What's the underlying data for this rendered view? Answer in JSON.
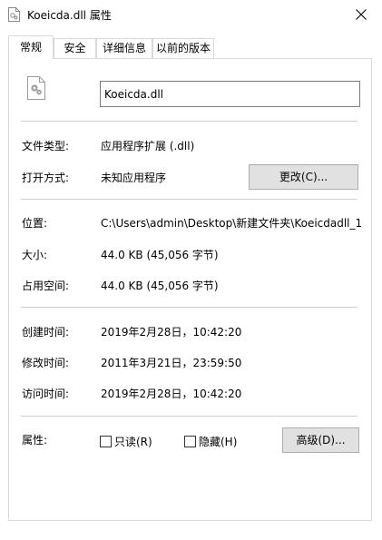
{
  "window": {
    "title": "Koeicda.dll 属性",
    "close_glyph": "✕"
  },
  "tabs": [
    {
      "label": "常规",
      "active": true
    },
    {
      "label": "安全",
      "active": false
    },
    {
      "label": "详细信息",
      "active": false
    },
    {
      "label": "以前的版本",
      "active": false
    }
  ],
  "general": {
    "file_name": "Koeicda.dll",
    "type_label": "文件类型:",
    "type_value": "应用程序扩展 (.dll)",
    "opens_label": "打开方式:",
    "opens_value": "未知应用程序",
    "change_button": "更改(C)...",
    "location_label": "位置:",
    "location_value": "C:\\Users\\admin\\Desktop\\新建文件夹\\Koeicdadll_1",
    "size_label": "大小:",
    "size_value": "44.0 KB (45,056 字节)",
    "disk_label": "占用空间:",
    "disk_value": "44.0 KB (45,056 字节)",
    "created_label": "创建时间:",
    "created_value": "2019年2月28日，10:42:20",
    "modified_label": "修改时间:",
    "modified_value": "2011年3月21日，23:59:50",
    "accessed_label": "访问时间:",
    "accessed_value": "2019年2月28日，10:42:20",
    "attr_label": "属性:",
    "readonly_label": "只读(R)",
    "readonly_checked": false,
    "hidden_label": "隐藏(H)",
    "hidden_checked": false,
    "advanced_button": "高级(D)..."
  },
  "colors": {
    "button_face": "#e1e1e1",
    "button_border": "#adadad",
    "separator": "#d0d0d0"
  }
}
